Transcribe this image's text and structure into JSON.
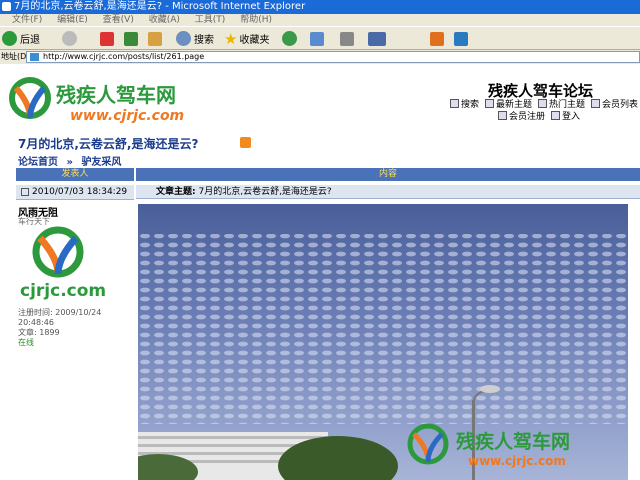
{
  "window": {
    "title": "7月的北京,云卷云舒,是海还是云? - Microsoft Internet Explorer"
  },
  "menu": [
    "文件(F)",
    "编辑(E)",
    "查看(V)",
    "收藏(A)",
    "工具(T)",
    "帮助(H)"
  ],
  "toolbar": {
    "back_label": "后退",
    "search_label": "搜索",
    "favorites_label": "收藏夹"
  },
  "address": {
    "label": "地址(D)",
    "url": "http://www.cjrjc.com/posts/list/261.page"
  },
  "site": {
    "logo_text": "残疾人驾车网",
    "logo_domain": "www.cjrjc.com",
    "forum_name": "残疾人驾车论坛",
    "nav": [
      {
        "icon": "search-icon",
        "label": "搜索"
      },
      {
        "icon": "new-topics-icon",
        "label": "最新主题"
      },
      {
        "icon": "hot-topics-icon",
        "label": "热门主题"
      },
      {
        "icon": "members-icon",
        "label": "会员列表"
      }
    ],
    "nav2": [
      {
        "icon": "register-icon",
        "label": "会员注册"
      },
      {
        "icon": "login-icon",
        "label": "登入"
      }
    ]
  },
  "topic": {
    "title": "7月的北京,云卷云舒,是海还是云?",
    "breadcrumb": {
      "home": "论坛首页",
      "separator": "»",
      "section": "驴友采风"
    }
  },
  "post": {
    "header_author": "发表人",
    "header_content": "内容",
    "date": "2010/07/03 18:34:29",
    "subject_label": "文章主题:",
    "subject": "7月的北京,云卷云舒,是海还是云?",
    "author": {
      "name": "风雨无阻",
      "title": "车行天下",
      "avatar_text": "cjrjc.com",
      "register_label": "注册时间:",
      "register_date": "2009/10/24",
      "register_time": "20:48:46",
      "posts_label": "文章:",
      "posts": "1899",
      "status": "在线"
    },
    "photo_watermark": "残疾人驾车网",
    "photo_watermark_domain": "www.cjrjc.com"
  },
  "colors": {
    "titlebar": "#1a6ad8",
    "header": "#4a72b8",
    "link": "#1b3b8c",
    "logo_orange": "#f07820",
    "logo_green": "#2c9a3c",
    "logo_blue": "#2a69c4"
  }
}
